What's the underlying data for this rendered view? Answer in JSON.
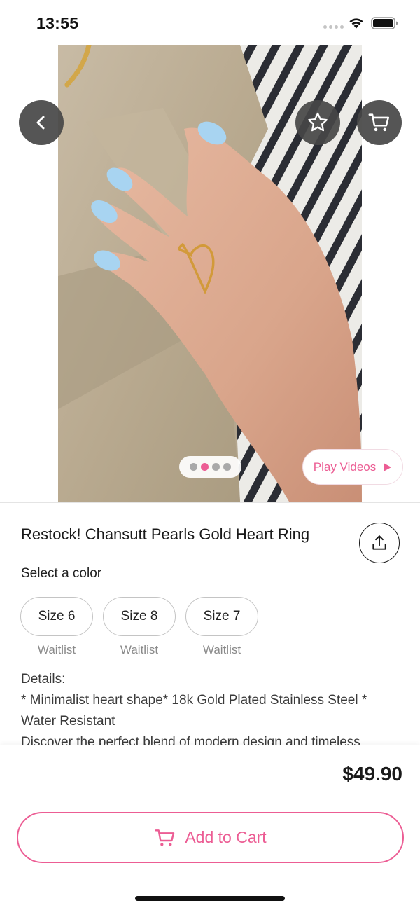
{
  "status_bar": {
    "time": "13:55"
  },
  "product": {
    "title": "Restock! Chansutt Pearls Gold Heart Ring",
    "select_label": "Select a color",
    "sizes": [
      {
        "label": "Size 6",
        "status": "Waitlist"
      },
      {
        "label": "Size 8",
        "status": "Waitlist"
      },
      {
        "label": "Size 7",
        "status": "Waitlist"
      }
    ],
    "details_heading": "Details:",
    "details_lines": [
      "* Minimalist heart shape* 18k Gold Plated Stainless Steel *",
      "Water Resistant",
      "Discover the perfect blend of modern design and timeless"
    ],
    "price": "$49.90"
  },
  "media": {
    "play_videos_label": "Play Videos",
    "pager": {
      "count": 4,
      "active_index": 1
    }
  },
  "actions": {
    "add_to_cart_label": "Add to Cart"
  },
  "icons": [
    "back-arrow-icon",
    "star-icon",
    "cart-icon",
    "share-icon",
    "play-icon",
    "wifi-icon",
    "battery-icon"
  ],
  "colors": {
    "accent": "#ec5d94",
    "icon_button_bg": "#464646",
    "text": "#1a1a1a",
    "muted": "#8a8a8a"
  }
}
